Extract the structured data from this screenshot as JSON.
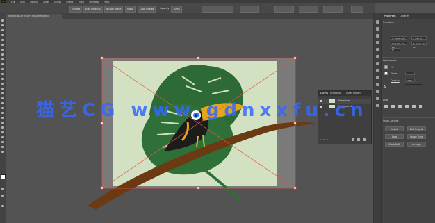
{
  "app": {
    "logo": "Ai"
  },
  "menubar": {
    "items": [
      "File",
      "Edit",
      "Object",
      "Type",
      "Select",
      "Effect",
      "View",
      "Window",
      "Help"
    ]
  },
  "control_bar": {
    "items": [
      "Embed",
      "Edit Original",
      "Image Trace",
      "Mask",
      "Crop Image",
      "Opacity",
      "100%"
    ]
  },
  "document": {
    "tab": "Illustration.ai @ 50% (RGB/Preview)"
  },
  "right_panel": {
    "tabs": [
      "Properties",
      "Libraries"
    ],
    "sections": {
      "transform": "Transform",
      "appearance": "Appearance",
      "align": "Align",
      "quick_actions": "Quick Actions"
    },
    "fields": {
      "x": "X: 1190.5 px",
      "y": "Y: 842 px",
      "w": "W: 1928.74 px",
      "h": "H: 1421.62 px",
      "angle": "0°",
      "opacity": "100%",
      "fill_label": "Fill",
      "stroke_label": "Stroke",
      "opacity_label": "Opacity"
    },
    "quick_actions": [
      "Embed",
      "Edit Original",
      "Crop",
      "Image Trace",
      "Mask/Split",
      "Arrange"
    ]
  },
  "layers_panel": {
    "tabs": [
      "Layers",
      "Artboards",
      "Asset Export"
    ],
    "rows": [
      "Illustration",
      "Background"
    ],
    "footer": "2 Layers"
  },
  "watermark": "猫艺CG  www.gdnxxfu.cn",
  "colors": {
    "canvas": "#535353",
    "artboard": "#d3e1c3",
    "leaf": "#2d6a36",
    "branch": "#6b3a12",
    "beak": "#e5a718",
    "selection": "#e05a4a",
    "watermark": "#3269ff"
  }
}
